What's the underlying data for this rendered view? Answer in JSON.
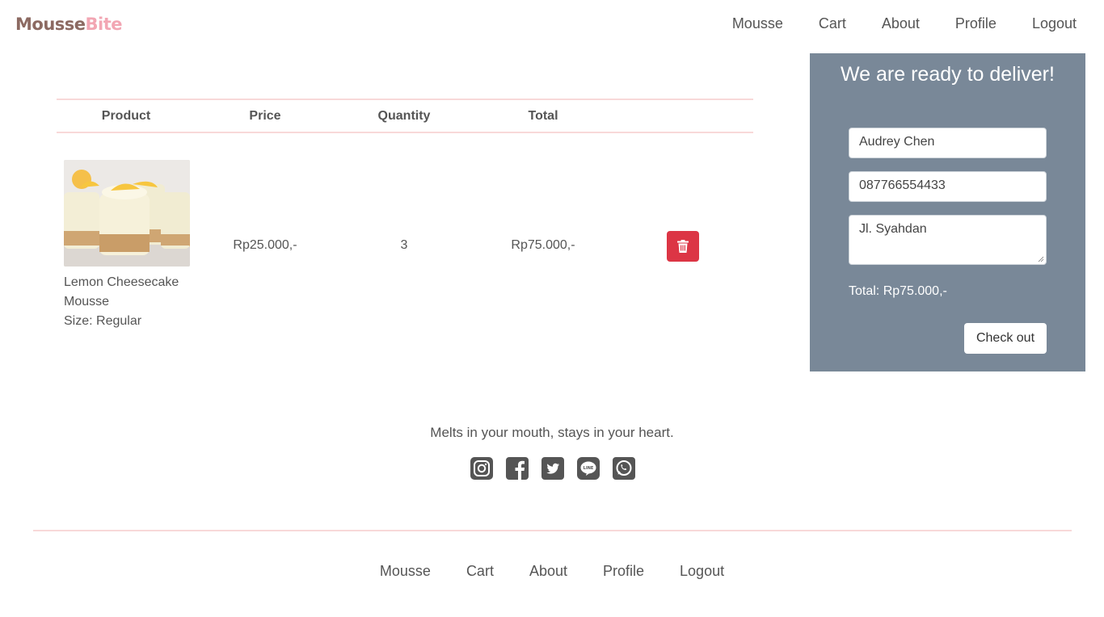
{
  "brand": {
    "part1": "Mousse",
    "part2": "Bite"
  },
  "nav": {
    "items": [
      "Mousse",
      "Cart",
      "About",
      "Profile",
      "Logout"
    ]
  },
  "cart": {
    "headers": [
      "Product",
      "Price",
      "Quantity",
      "Total"
    ],
    "items": [
      {
        "name": "Lemon Cheesecake Mousse",
        "size": "Size: Regular",
        "price": "Rp25.000,-",
        "quantity": "3",
        "total": "Rp75.000,-",
        "delete_icon": "trash-icon"
      }
    ]
  },
  "delivery": {
    "title": "We are ready to deliver!",
    "name_value": "Audrey Chen",
    "phone_value": "087766554433",
    "address_value": "Jl. Syahdan",
    "total": "Total: Rp75.000,-",
    "checkout_label": "Check out"
  },
  "footer": {
    "tagline": "Melts in your mouth, stays in your heart.",
    "social_icons": [
      "instagram-icon",
      "facebook-icon",
      "twitter-icon",
      "line-icon",
      "whatsapp-icon"
    ],
    "nav": [
      "Mousse",
      "Cart",
      "About",
      "Profile",
      "Logout"
    ]
  },
  "colors": {
    "panel_bg": "#798898",
    "delete_red": "#dc3545",
    "divider_pink": "#f8d9d9",
    "brand_brown": "#8c6a62",
    "brand_pink": "#f2a6b3"
  }
}
